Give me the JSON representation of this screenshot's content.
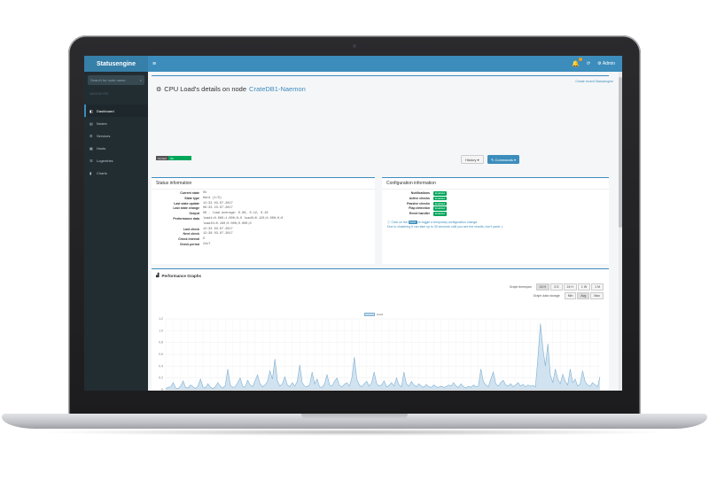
{
  "app": {
    "brand": "Statusengine",
    "user": "Admin"
  },
  "sidebar": {
    "search_placeholder": "Search for node name",
    "header": "Navigation",
    "items": [
      {
        "label": "Dashboard",
        "icon": "dashboard-icon",
        "active": true
      },
      {
        "label": "Nodes",
        "icon": "server-icon",
        "active": false
      },
      {
        "label": "Services",
        "icon": "cog-icon",
        "active": false
      },
      {
        "label": "Hosts",
        "icon": "host-icon",
        "active": false
      },
      {
        "label": "Logentries",
        "icon": "list-icon",
        "active": false
      },
      {
        "label": "Charts",
        "icon": "chart-icon",
        "active": false
      }
    ]
  },
  "header": {
    "create_link": "Create recent Statusengine",
    "title_prefix": "CPU Load's details on node",
    "host_name": "CrateDB1-Naemon",
    "status_label": "Current",
    "status_value": "Ok",
    "history_button": "History",
    "commands_button": "Commands"
  },
  "status_info": {
    "title": "Status information",
    "rows": [
      {
        "key": "Current state",
        "value": "Ok"
      },
      {
        "key": "State type",
        "value": "Hard (1/3)"
      },
      {
        "key": "Last state update",
        "value": "12:33 03.07.2017"
      },
      {
        "key": "Last state change",
        "value": "06:33 23.07.2017"
      },
      {
        "key": "Output",
        "value": "OK - load average: 0.06, 0.12, 0.16"
      },
      {
        "key": "Performance data",
        "value": "load1=0.060;1.000;0;0 load5=0.120;0.000;0;0"
      },
      {
        "key": "",
        "value": "load15=0.160;0.000;0.000;0"
      },
      {
        "key": "Last check",
        "value": "12:33 03.07.2017"
      },
      {
        "key": "Next check",
        "value": "12:38 03.07.2017"
      },
      {
        "key": "Check interval",
        "value": "5"
      },
      {
        "key": "Check period",
        "value": "24x7"
      }
    ]
  },
  "config_info": {
    "title": "Configuration information",
    "rows": [
      {
        "key": "Notifications",
        "value": "Enabled"
      },
      {
        "key": "Active checks",
        "value": "Enabled"
      },
      {
        "key": "Passive checks",
        "value": "Enabled"
      },
      {
        "key": "Flap detection",
        "value": "Enabled"
      },
      {
        "key": "Event handler",
        "value": "Enabled"
      }
    ],
    "info_line_1_a": "Click on the",
    "info_line_1_here": "here",
    "info_line_1_b": "to toggle a temporary configuration change.",
    "info_line_2": "Due to clustering it can take up to 30 seconds until you see the results, don't panic :)"
  },
  "performance": {
    "title": "Performance Graphs",
    "timespan_label": "Graph timespan",
    "timespan_options": [
      "24 H",
      "3 D",
      "24 H",
      "1 W",
      "1 M"
    ],
    "timespan_selected": 0,
    "aggregation_label": "Graph data storage",
    "aggregation_options": [
      "Min",
      "Avg",
      "Max"
    ],
    "aggregation_selected": 1,
    "legend": "load1"
  },
  "chart_data": {
    "type": "area",
    "series": [
      {
        "name": "load1",
        "color": "#7fb0d2"
      }
    ],
    "ylim": [
      0,
      1.2
    ],
    "yticks": [
      "1.2",
      "1.0",
      "0.8",
      "0.6",
      "0.4",
      "0.2",
      "0"
    ],
    "values": [
      0.02,
      0.04,
      0.05,
      0.12,
      0.03,
      0.02,
      0.06,
      0.15,
      0.04,
      0.03,
      0.08,
      0.05,
      0.02,
      0.06,
      0.18,
      0.05,
      0.03,
      0.1,
      0.04,
      0.02,
      0.05,
      0.12,
      0.06,
      0.03,
      0.07,
      0.35,
      0.08,
      0.04,
      0.05,
      0.12,
      0.2,
      0.06,
      0.04,
      0.16,
      0.08,
      0.05,
      0.15,
      0.25,
      0.1,
      0.05,
      0.08,
      0.14,
      0.32,
      0.18,
      0.52,
      0.15,
      0.06,
      0.1,
      0.22,
      0.08,
      0.05,
      0.12,
      0.06,
      0.14,
      0.42,
      0.12,
      0.06,
      0.05,
      0.08,
      0.3,
      0.1,
      0.18,
      0.05,
      0.04,
      0.1,
      0.26,
      0.08,
      0.06,
      0.14,
      0.2,
      0.07,
      0.05,
      0.09,
      0.12,
      0.06,
      0.2,
      0.55,
      0.18,
      0.08,
      0.05,
      0.1,
      0.14,
      0.06,
      0.12,
      0.3,
      0.1,
      0.06,
      0.08,
      0.15,
      0.05,
      0.07,
      0.12,
      0.06,
      0.2,
      0.08,
      0.05,
      0.3,
      0.1,
      0.06,
      0.14,
      0.08,
      0.05,
      0.1,
      0.06,
      0.04,
      0.09,
      0.05,
      0.04,
      0.08,
      0.05,
      0.04,
      0.06,
      0.04,
      0.05,
      0.08,
      0.06,
      0.12,
      0.06,
      0.04,
      0.1,
      0.05,
      0.03,
      0.06,
      0.04,
      0.08,
      0.05,
      0.06,
      0.35,
      0.14,
      0.08,
      0.05,
      0.18,
      0.3,
      0.1,
      0.06,
      0.12,
      0.16,
      0.08,
      0.06,
      0.1,
      0.05,
      0.08,
      0.12,
      0.06,
      0.09,
      0.05,
      0.08,
      0.06,
      0.07,
      0.05,
      0.55,
      1.12,
      0.7,
      0.4,
      0.78,
      0.25,
      0.12,
      0.35,
      0.18,
      0.1,
      0.26,
      0.14,
      0.08,
      0.35,
      0.12,
      0.18,
      0.06,
      0.1,
      0.32,
      0.14,
      0.08,
      0.06,
      0.12,
      0.08,
      0.05,
      0.22
    ]
  }
}
